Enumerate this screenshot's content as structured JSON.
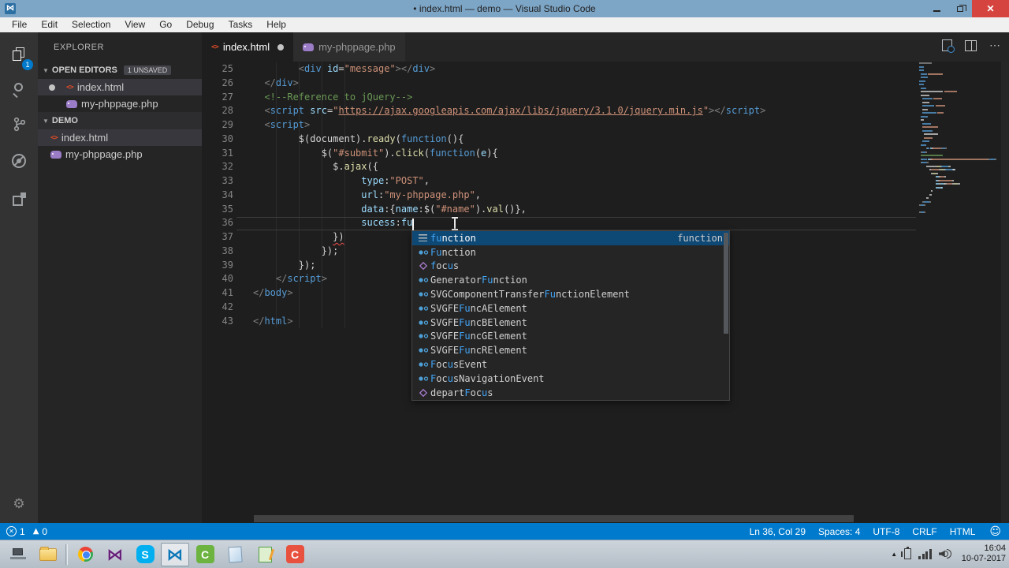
{
  "colors": {
    "statusbar": "#007acc",
    "titlebar": "#7da5c6",
    "titlebar_close": "#d6443f",
    "suggest_selected": "#0e4875",
    "match": "#42a5f5",
    "error_squiggle": "#f14c4c"
  },
  "window": {
    "title": "• index.html — demo — Visual Studio Code"
  },
  "menu": {
    "items": [
      "File",
      "Edit",
      "Selection",
      "View",
      "Go",
      "Debug",
      "Tasks",
      "Help"
    ]
  },
  "activity_bar": {
    "explorer_badge": "1",
    "icons": [
      "files-icon",
      "search-icon",
      "source-control-icon",
      "debug-icon",
      "extensions-icon",
      "settings-gear-icon"
    ]
  },
  "sidebar": {
    "title": "EXPLORER",
    "open_editors": {
      "label": "OPEN EDITORS",
      "badge": "1 UNSAVED",
      "items": [
        {
          "name": "index.html",
          "icon": "html-file-icon",
          "modified": true,
          "selected": true
        },
        {
          "name": "my-phppage.php",
          "icon": "php-file-icon",
          "modified": false,
          "selected": false
        }
      ]
    },
    "folder": {
      "label": "DEMO",
      "items": [
        {
          "name": "index.html",
          "icon": "html-file-icon",
          "selected": true
        },
        {
          "name": "my-phppage.php",
          "icon": "php-file-icon",
          "selected": false
        }
      ]
    }
  },
  "tabs": [
    {
      "label": "index.html",
      "icon": "html-file-icon",
      "modified": true,
      "active": true
    },
    {
      "label": "my-phppage.php",
      "icon": "php-file-icon",
      "modified": false,
      "active": false
    }
  ],
  "editor": {
    "lines": [
      {
        "n": 25,
        "s": [
          [
            "        ",
            "d"
          ],
          [
            "<",
            "p"
          ],
          [
            "div",
            "t"
          ],
          [
            " ",
            "d"
          ],
          [
            "id",
            "a"
          ],
          [
            "=",
            "d"
          ],
          [
            "\"message\"",
            "s"
          ],
          [
            ">",
            "p"
          ],
          [
            "</",
            "p"
          ],
          [
            "div",
            "t"
          ],
          [
            ">",
            "p"
          ]
        ]
      },
      {
        "n": 26,
        "s": [
          [
            "  ",
            "d"
          ],
          [
            "</",
            "p"
          ],
          [
            "div",
            "t"
          ],
          [
            ">",
            "p"
          ]
        ]
      },
      {
        "n": 27,
        "s": [
          [
            "  ",
            "d"
          ],
          [
            "<!--Reference to jQuery-->",
            "c"
          ]
        ]
      },
      {
        "n": 28,
        "s": [
          [
            "  ",
            "d"
          ],
          [
            "<",
            "p"
          ],
          [
            "script",
            "t"
          ],
          [
            " ",
            "d"
          ],
          [
            "src",
            "a"
          ],
          [
            "=",
            "d"
          ],
          [
            "\"",
            "s"
          ],
          [
            "https://ajax.googleapis.com/ajax/libs/jquery/3.1.0/jquery.min.js",
            "u"
          ],
          [
            "\"",
            "s"
          ],
          [
            ">",
            "p"
          ],
          [
            "</",
            "p"
          ],
          [
            "script",
            "t"
          ],
          [
            ">",
            "p"
          ]
        ]
      },
      {
        "n": 29,
        "s": [
          [
            "  ",
            "d"
          ],
          [
            "<",
            "p"
          ],
          [
            "script",
            "t"
          ],
          [
            ">",
            "p"
          ]
        ]
      },
      {
        "n": 30,
        "s": [
          [
            "        $(document).",
            "d"
          ],
          [
            "ready",
            "f"
          ],
          [
            "(",
            "d"
          ],
          [
            "function",
            "k"
          ],
          [
            "(){",
            "d"
          ]
        ]
      },
      {
        "n": 31,
        "s": [
          [
            "            $(",
            "d"
          ],
          [
            "\"#submit\"",
            "s"
          ],
          [
            ").",
            "d"
          ],
          [
            "click",
            "f"
          ],
          [
            "(",
            "d"
          ],
          [
            "function",
            "k"
          ],
          [
            "(",
            "d"
          ],
          [
            "e",
            "a"
          ],
          [
            "){",
            "d"
          ]
        ]
      },
      {
        "n": 32,
        "s": [
          [
            "              $.",
            "d"
          ],
          [
            "ajax",
            "f"
          ],
          [
            "({",
            "d"
          ]
        ]
      },
      {
        "n": 33,
        "s": [
          [
            "                   ",
            "d"
          ],
          [
            "type",
            "a"
          ],
          [
            ":",
            "d"
          ],
          [
            "\"POST\"",
            "s"
          ],
          [
            ",",
            "d"
          ]
        ]
      },
      {
        "n": 34,
        "s": [
          [
            "                   ",
            "d"
          ],
          [
            "url",
            "a"
          ],
          [
            ":",
            "d"
          ],
          [
            "\"my-phppage.php\"",
            "s"
          ],
          [
            ",",
            "d"
          ]
        ]
      },
      {
        "n": 35,
        "s": [
          [
            "                   ",
            "d"
          ],
          [
            "data",
            "a"
          ],
          [
            ":{",
            "d"
          ],
          [
            "name",
            "a"
          ],
          [
            ":",
            "d"
          ],
          [
            "$(",
            "d"
          ],
          [
            "\"#name\"",
            "s"
          ],
          [
            ").",
            "d"
          ],
          [
            "val",
            "f"
          ],
          [
            "()},",
            "d"
          ]
        ]
      },
      {
        "n": 36,
        "s": [
          [
            "                   ",
            "d"
          ],
          [
            "sucess",
            "a"
          ],
          [
            ":",
            "d"
          ],
          [
            "fu",
            "a"
          ]
        ]
      },
      {
        "n": 37,
        "s": [
          [
            "              ",
            "d"
          ],
          [
            "})",
            "dq"
          ]
        ]
      },
      {
        "n": 38,
        "s": [
          [
            "            });",
            "d"
          ]
        ]
      },
      {
        "n": 39,
        "s": [
          [
            "        });",
            "d"
          ]
        ]
      },
      {
        "n": 40,
        "s": [
          [
            "    ",
            "d"
          ],
          [
            "</",
            "p"
          ],
          [
            "script",
            "t"
          ],
          [
            ">",
            "p"
          ]
        ]
      },
      {
        "n": 41,
        "s": [
          [
            "</",
            "p"
          ],
          [
            "body",
            "t"
          ],
          [
            ">",
            "p"
          ]
        ]
      },
      {
        "n": 42,
        "s": []
      },
      {
        "n": 43,
        "s": [
          [
            "</",
            "p"
          ],
          [
            "html",
            "t"
          ],
          [
            ">",
            "p"
          ]
        ]
      }
    ],
    "cursor": {
      "line": 36,
      "col": 29
    }
  },
  "suggest": {
    "items": [
      {
        "icon": "snippet-icon",
        "detail": "function",
        "selected": true,
        "segs": [
          [
            "fu",
            1
          ],
          [
            "nction",
            0
          ]
        ]
      },
      {
        "icon": "class-icon",
        "segs": [
          [
            "Fu",
            1
          ],
          [
            "nction",
            0
          ]
        ]
      },
      {
        "icon": "property-icon",
        "segs": [
          [
            "f",
            1
          ],
          [
            "oc",
            0
          ],
          [
            "u",
            1
          ],
          [
            "s",
            0
          ]
        ]
      },
      {
        "icon": "class-icon",
        "segs": [
          [
            "Generator",
            0
          ],
          [
            "Fu",
            1
          ],
          [
            "nction",
            0
          ]
        ]
      },
      {
        "icon": "class-icon",
        "segs": [
          [
            "SVGComponentTransfer",
            0
          ],
          [
            "Fu",
            1
          ],
          [
            "nctionElement",
            0
          ]
        ]
      },
      {
        "icon": "class-icon",
        "segs": [
          [
            "SVGFE",
            0
          ],
          [
            "Fu",
            1
          ],
          [
            "ncAElement",
            0
          ]
        ]
      },
      {
        "icon": "class-icon",
        "segs": [
          [
            "SVGFE",
            0
          ],
          [
            "Fu",
            1
          ],
          [
            "ncBElement",
            0
          ]
        ]
      },
      {
        "icon": "class-icon",
        "segs": [
          [
            "SVGFE",
            0
          ],
          [
            "Fu",
            1
          ],
          [
            "ncGElement",
            0
          ]
        ]
      },
      {
        "icon": "class-icon",
        "segs": [
          [
            "SVGFE",
            0
          ],
          [
            "Fu",
            1
          ],
          [
            "ncRElement",
            0
          ]
        ]
      },
      {
        "icon": "class-icon",
        "segs": [
          [
            "F",
            1
          ],
          [
            "oc",
            0
          ],
          [
            "u",
            1
          ],
          [
            "sEvent",
            0
          ]
        ]
      },
      {
        "icon": "class-icon",
        "segs": [
          [
            "F",
            1
          ],
          [
            "oc",
            0
          ],
          [
            "u",
            1
          ],
          [
            "sNavigationEvent",
            0
          ]
        ]
      },
      {
        "icon": "property-icon",
        "segs": [
          [
            "depart",
            0
          ],
          [
            "F",
            1
          ],
          [
            "oc",
            0
          ],
          [
            "u",
            1
          ],
          [
            "s",
            0
          ]
        ]
      }
    ]
  },
  "minimap": {
    "head_rows": [
      [
        [
          0,
          15,
          "p"
        ]
      ],
      [
        [
          0,
          6,
          "t"
        ]
      ],
      [
        [
          0,
          6,
          "t"
        ]
      ],
      [
        [
          2,
          7,
          "t"
        ],
        [
          10,
          18,
          "s"
        ]
      ],
      [
        [
          2,
          8,
          "t"
        ]
      ],
      [
        [
          0,
          7,
          "t"
        ]
      ],
      [
        [
          0,
          6,
          "t"
        ]
      ],
      [
        [
          2,
          6,
          "t"
        ]
      ],
      [
        [
          2,
          26,
          "d"
        ],
        [
          30,
          14,
          "s"
        ]
      ],
      [
        [
          2,
          10,
          "d"
        ]
      ],
      [
        [
          4,
          12,
          "t"
        ],
        [
          17,
          10,
          "s"
        ]
      ],
      [
        [
          4,
          8,
          "d"
        ]
      ],
      [
        [
          4,
          14,
          "t"
        ],
        [
          19,
          12,
          "s"
        ]
      ],
      [
        [
          4,
          6,
          "d"
        ]
      ],
      [
        [
          4,
          16,
          "t"
        ],
        [
          21,
          8,
          "s"
        ]
      ],
      [
        [
          2,
          8,
          "t"
        ]
      ],
      [
        [
          2,
          4,
          "d"
        ]
      ],
      [
        [
          4,
          10,
          "t"
        ]
      ],
      [
        [
          4,
          18,
          "s"
        ]
      ],
      [
        [
          4,
          12,
          "t"
        ]
      ],
      [
        [
          6,
          16,
          "d"
        ]
      ],
      [
        [
          6,
          10,
          "s"
        ]
      ],
      [
        [
          4,
          8,
          "t"
        ]
      ],
      [
        [
          2,
          6,
          "t"
        ]
      ]
    ]
  },
  "status_bar": {
    "errors": "1",
    "warnings": "0",
    "line_col": "Ln 36, Col 29",
    "indentation": "Spaces: 4",
    "encoding": "UTF-8",
    "eol": "CRLF",
    "language": "HTML"
  },
  "taskbar": {
    "items": [
      {
        "icon": "start-laptop-icon"
      },
      {
        "icon": "file-explorer-icon"
      },
      {
        "icon": "separator"
      },
      {
        "icon": "chrome-icon"
      },
      {
        "icon": "visual-studio-icon"
      },
      {
        "icon": "skype-icon"
      },
      {
        "icon": "vscode-icon",
        "active": true
      },
      {
        "icon": "camtasia-icon"
      },
      {
        "icon": "notepad-icon"
      },
      {
        "icon": "notes-icon"
      },
      {
        "icon": "camtasia-recorder-icon"
      }
    ]
  },
  "tray": {
    "time": "16:04",
    "date": "10-07-2017"
  }
}
